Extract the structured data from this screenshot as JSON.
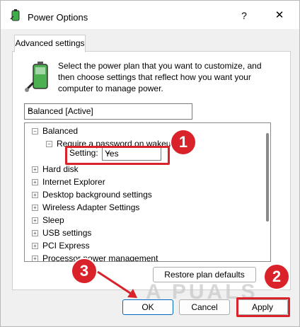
{
  "window": {
    "title": "Power Options",
    "help": "?",
    "close": "✕"
  },
  "tab": {
    "label": "Advanced settings"
  },
  "description": "Select the power plan that you want to customize, and then choose settings that reflect how you want your computer to manage power.",
  "plan_select": {
    "value": "Balanced [Active]"
  },
  "tree": {
    "balanced": "Balanced",
    "require_password": "Require a password on wakeup",
    "setting_label": "Setting:",
    "setting_value": "Yes",
    "items": [
      "Hard disk",
      "Internet Explorer",
      "Desktop background settings",
      "Wireless Adapter Settings",
      "Sleep",
      "USB settings",
      "PCI Express",
      "Processor power management"
    ]
  },
  "buttons": {
    "restore": "Restore plan defaults",
    "ok": "OK",
    "cancel": "Cancel",
    "apply": "Apply"
  },
  "annotations": {
    "badge1": "1",
    "badge2": "2",
    "badge3": "3",
    "watermark": "A PUALS"
  },
  "colors": {
    "annotation_red": "#d9222a",
    "ok_border": "#0067c0"
  }
}
